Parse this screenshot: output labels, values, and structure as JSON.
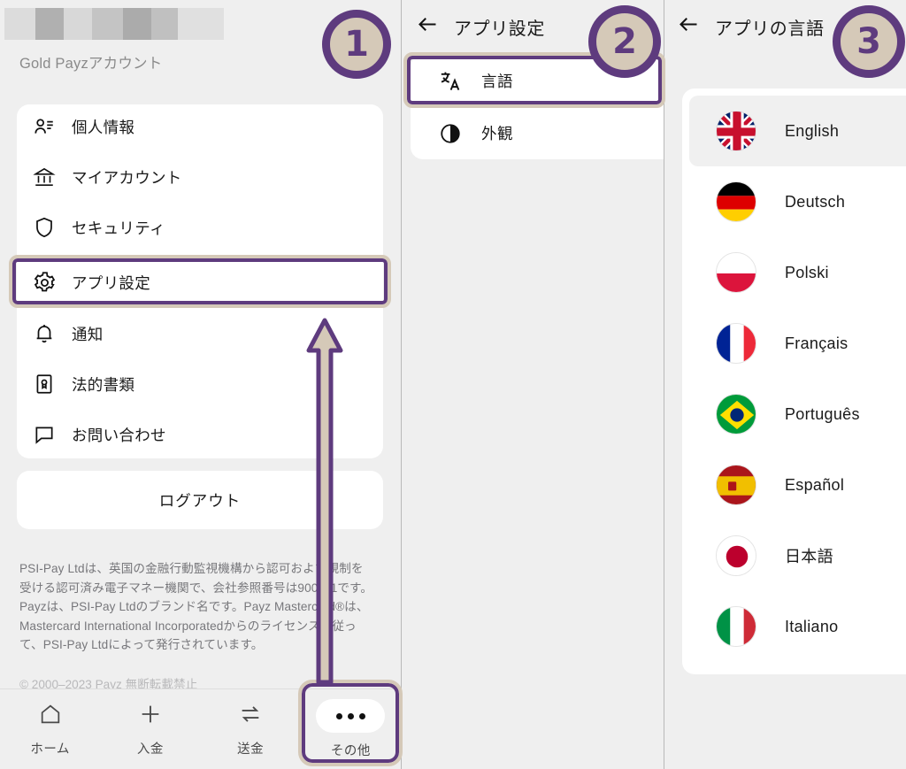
{
  "colors": {
    "accent_purple": "#5e3b7e",
    "badge_fill": "#d5c9b8",
    "panel_bg": "#efefef",
    "card_bg": "#ffffff",
    "text_primary": "#1a1a1a",
    "text_muted": "#8a8a8a",
    "selected_row": "#f0f0f0"
  },
  "panel1": {
    "account_type": "Gold Payzアカウント",
    "redacted_name": "",
    "menu_items": [
      {
        "label": "個人情報",
        "icon": "person-card-icon"
      },
      {
        "label": "マイアカウント",
        "icon": "bank-icon"
      },
      {
        "label": "セキュリティ",
        "icon": "shield-icon"
      },
      {
        "label": "アプリ設定",
        "icon": "gear-icon"
      },
      {
        "label": "通知",
        "icon": "bell-icon"
      },
      {
        "label": "法的書類",
        "icon": "certificate-icon"
      },
      {
        "label": "お問い合わせ",
        "icon": "chat-bubble-icon"
      }
    ],
    "logout_label": "ログアウト",
    "legal_text": "PSI-Pay Ltdは、英国の金融行動監視機構から認可および規制を受ける認可済み電子マネー機関で、会社参照番号は900011です。Payzは、PSI-Pay Ltdのブランド名です。Payz Mastercard®は、Mastercard International Incorporatedからのライセンスに従って、PSI-Pay Ltdによって発行されています。",
    "legal_text_2": "© 2000–2023  Payz  無断転載禁止",
    "bottom_nav": [
      {
        "label": "ホーム",
        "icon": "home-icon"
      },
      {
        "label": "入金",
        "icon": "plus-icon"
      },
      {
        "label": "送金",
        "icon": "transfer-icon"
      },
      {
        "label": "その他",
        "icon": "more-dots-icon"
      }
    ]
  },
  "panel2": {
    "header_title": "アプリ設定",
    "back_icon": "back-arrow-icon",
    "items": [
      {
        "label": "言語",
        "icon": "translate-icon"
      },
      {
        "label": "外観",
        "icon": "contrast-icon"
      }
    ]
  },
  "panel3": {
    "header_title": "アプリの言語",
    "back_icon": "back-arrow-icon",
    "languages": [
      {
        "label": "English",
        "flag": "flag-uk",
        "selected": true
      },
      {
        "label": "Deutsch",
        "flag": "flag-germany",
        "selected": false
      },
      {
        "label": "Polski",
        "flag": "flag-poland",
        "selected": false
      },
      {
        "label": "Français",
        "flag": "flag-france",
        "selected": false
      },
      {
        "label": "Português",
        "flag": "flag-brazil",
        "selected": false
      },
      {
        "label": "Español",
        "flag": "flag-spain",
        "selected": false
      },
      {
        "label": "日本語",
        "flag": "flag-japan",
        "selected": false
      },
      {
        "label": "Italiano",
        "flag": "flag-italy",
        "selected": false
      }
    ]
  },
  "annotations": {
    "badges": [
      {
        "number": "①",
        "text": "1"
      },
      {
        "number": "②",
        "text": "2"
      },
      {
        "number": "③",
        "text": "3"
      }
    ],
    "badge1": "1",
    "badge2": "2",
    "badge3": "3"
  }
}
